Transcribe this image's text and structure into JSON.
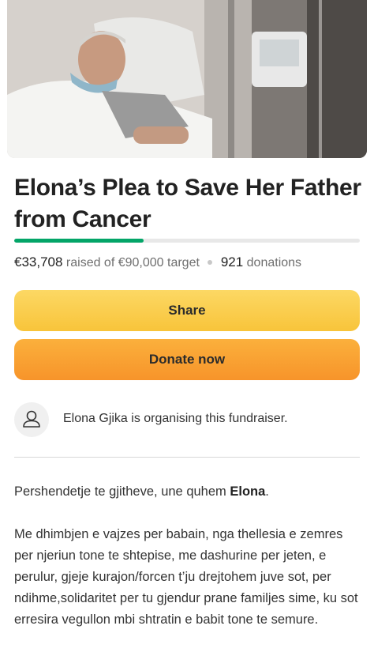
{
  "campaign": {
    "title": "Elona’s Plea to Save Her Father from Cancer",
    "progress_fraction": 0.374,
    "raised": "€33,708",
    "raised_suffix": "raised of €90,000 target",
    "donations_count": "921",
    "donations_label": "donations"
  },
  "actions": {
    "share_label": "Share",
    "donate_label": "Donate now"
  },
  "organiser": {
    "text": "Elona Gjika is organising this fundraiser.",
    "icon": "user-icon"
  },
  "story": {
    "greeting_prefix": "Pershendetje te gjitheve, une quhem ",
    "greeting_name": "Elona",
    "greeting_suffix": ".",
    "paragraph": "Me dhimbjen e vajzes per babain, nga thellesia e zemres per njeriun tone te shtepise, me dashurine per jeten, e perulur, gjeje kurajon/forcen t’ju drejtohem juve sot, per ndihme,solidaritet per tu gjendur prane familjes sime, ku sot erresira vegullon mbi shtratin e babit tone te semure."
  },
  "colors": {
    "progress": "#03a568",
    "share_button": "#f8c43a",
    "donate_button": "#f7942a"
  }
}
